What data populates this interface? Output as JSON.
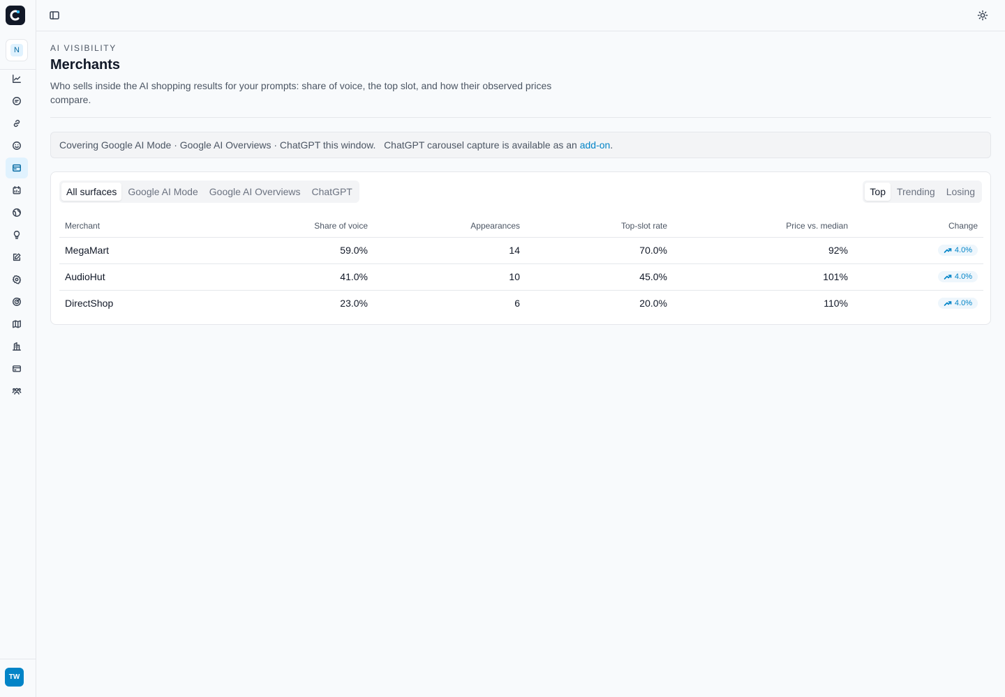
{
  "sidebar": {
    "workspace_initial": "N",
    "items": [
      {
        "icon": "chart-line-icon"
      },
      {
        "icon": "chat-bubble-icon"
      },
      {
        "icon": "link-icon"
      },
      {
        "icon": "smile-icon"
      },
      {
        "icon": "store-icon",
        "active": true
      },
      {
        "icon": "calendar-icon"
      },
      {
        "icon": "globe-icon"
      },
      {
        "icon": "lightbulb-icon"
      },
      {
        "icon": "edit-icon"
      },
      {
        "icon": "gear-icon"
      },
      {
        "icon": "target-icon"
      },
      {
        "icon": "map-icon"
      },
      {
        "icon": "building-icon"
      },
      {
        "icon": "credit-card-icon"
      },
      {
        "icon": "users-icon"
      }
    ],
    "user_initials": "TW"
  },
  "header": {
    "eyebrow": "AI VISIBILITY",
    "title": "Merchants",
    "subtitle": "Who sells inside the AI shopping results for your prompts: share of voice, the top slot, and how their observed prices compare."
  },
  "notice": {
    "text": "Covering Google AI Mode · Google AI Overviews · ChatGPT this window.   ChatGPT carousel capture is available as an ",
    "link": "add-on",
    "suffix": "."
  },
  "surface_tabs": [
    "All surfaces",
    "Google AI Mode",
    "Google AI Overviews",
    "ChatGPT"
  ],
  "surface_tabs_active": "All surfaces",
  "sort_tabs": [
    "Top",
    "Trending",
    "Losing"
  ],
  "sort_tabs_active": "Top",
  "table": {
    "columns": [
      "Merchant",
      "Share of voice",
      "Appearances",
      "Top-slot rate",
      "Price vs. median",
      "Change"
    ],
    "rows": [
      {
        "merchant": "MegaMart",
        "share": "59.0%",
        "appearances": "14",
        "top_slot": "70.0%",
        "price": "92%",
        "change": "4.0%"
      },
      {
        "merchant": "AudioHut",
        "share": "41.0%",
        "appearances": "10",
        "top_slot": "45.0%",
        "price": "101%",
        "change": "4.0%"
      },
      {
        "merchant": "DirectShop",
        "share": "23.0%",
        "appearances": "6",
        "top_slot": "20.0%",
        "price": "110%",
        "change": "4.0%"
      }
    ]
  },
  "colors": {
    "accent": "#0284c7",
    "active_bg": "#e0f2fe"
  }
}
